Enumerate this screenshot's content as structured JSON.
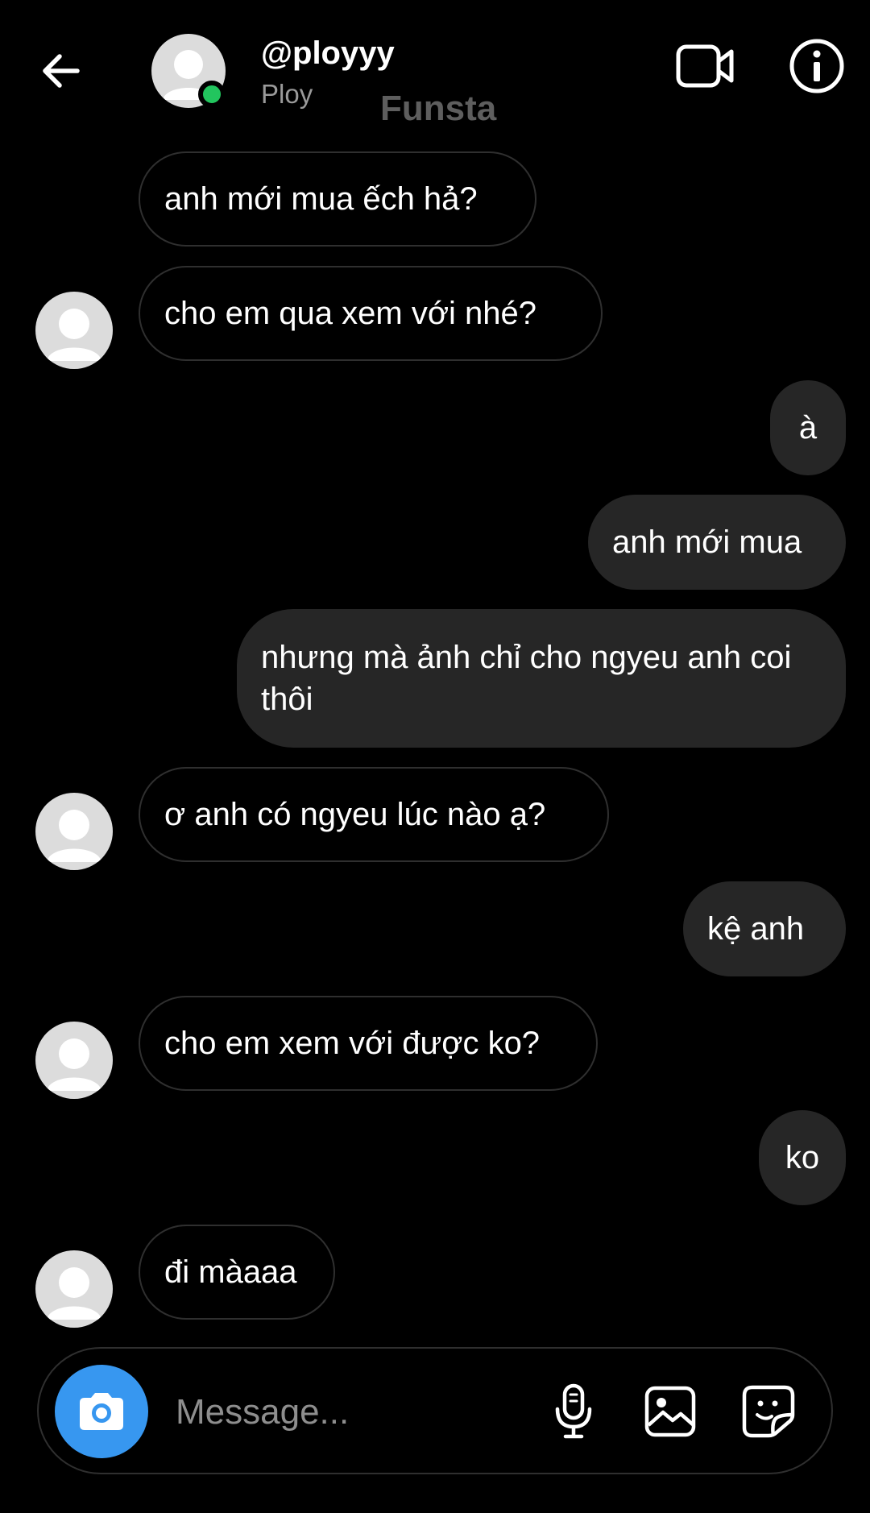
{
  "header": {
    "username": "@ployyy",
    "fullname": "Ploy",
    "watermark": "Funsta"
  },
  "messages": [
    {
      "side": "in",
      "text": "anh mới mua ếch hả?"
    },
    {
      "side": "in",
      "text": "cho em qua xem với nhé?"
    },
    {
      "side": "out",
      "text": "à"
    },
    {
      "side": "out",
      "text": "anh mới mua"
    },
    {
      "side": "out",
      "text": "nhưng mà ảnh chỉ cho ngyeu anh coi thôi"
    },
    {
      "side": "in",
      "text": "ơ anh có ngyeu lúc nào ạ?"
    },
    {
      "side": "out",
      "text": "kệ anh"
    },
    {
      "side": "in",
      "text": "cho em xem với được ko?"
    },
    {
      "side": "out",
      "text": "ko"
    },
    {
      "side": "in",
      "text": "đi màaaa"
    }
  ],
  "composer": {
    "placeholder": "Message..."
  },
  "icons": {
    "back": "arrow-left-icon",
    "video": "video-camera-icon",
    "info": "info-icon",
    "camera": "camera-icon",
    "mic": "microphone-icon",
    "gallery": "image-icon",
    "sticker": "sticker-icon"
  },
  "colors": {
    "background": "#000000",
    "outgoing_bubble": "#262626",
    "incoming_border": "#2f2f2f",
    "camera_button": "#3797f0",
    "online_dot": "#22c55e",
    "secondary_text": "#9a9a9a",
    "watermark": "#5e5e5e"
  }
}
